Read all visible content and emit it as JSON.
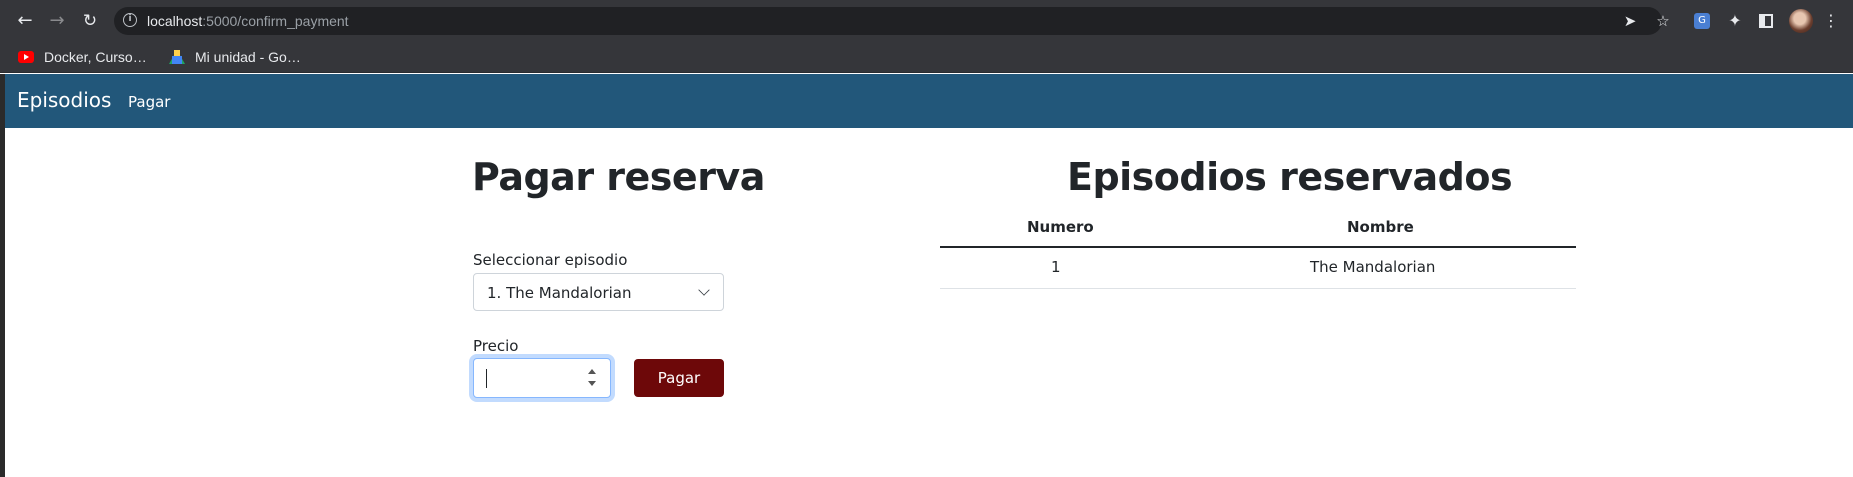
{
  "browser": {
    "url_host": "localhost",
    "url_path": ":5000/confirm_payment",
    "bookmarks": [
      {
        "label": "Docker, Curso…",
        "icon": "youtube-icon"
      },
      {
        "label": "Mi unidad - Go…",
        "icon": "google-drive-icon"
      }
    ]
  },
  "navbar": {
    "brand": "Episodios",
    "links": [
      "Pagar"
    ]
  },
  "payment_form": {
    "title": "Pagar reserva",
    "select_label": "Seleccionar episodio",
    "selected_episode": "1. The Mandalorian",
    "price_label": "Precio",
    "price_value": "",
    "submit_label": "Pagar"
  },
  "reserved": {
    "title": "Episodios reservados",
    "columns": [
      "Numero",
      "Nombre"
    ],
    "rows": [
      {
        "numero": "1",
        "nombre": "The Mandalorian"
      }
    ]
  },
  "colors": {
    "navbar": "#22577a",
    "pay_button": "#6d0809",
    "focus_ring": "#86b7fe"
  }
}
